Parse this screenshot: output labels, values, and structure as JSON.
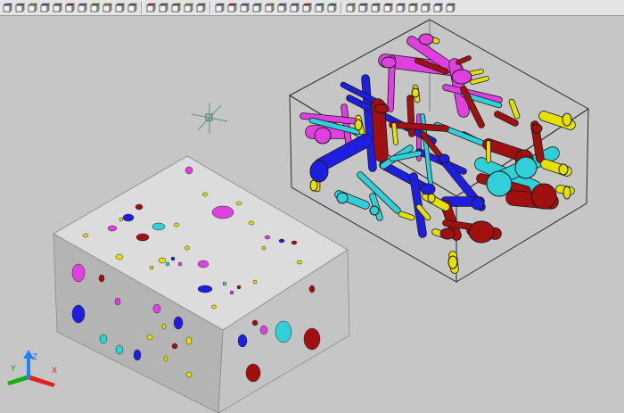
{
  "toolbar": {
    "groups": [
      [
        "box-icon",
        "wedge-icon",
        "sweep-icon",
        "revolve-icon",
        "extrude-icon",
        "loft-icon",
        "union-icon",
        "subtract-icon",
        "intersect-icon",
        "imprint-icon",
        "slice-icon"
      ],
      [
        "section-icon",
        "interference-icon",
        "mass-props-icon",
        "solid-edit-icon",
        "face-color-icon"
      ],
      [
        "top-view-icon",
        "bottom-view-icon",
        "left-view-icon",
        "right-view-icon",
        "front-view-icon",
        "back-view-icon",
        "sw-iso-icon",
        "se-iso-icon",
        "ne-iso-icon",
        "nw-iso-icon"
      ],
      [
        "orbit-icon",
        "pan-icon",
        "zoom-icon",
        "walk-icon",
        "fly-icon",
        "camera-icon",
        "visual-style-icon",
        "render-icon",
        "lights-icon"
      ]
    ]
  },
  "colors": {
    "background": "#c6c6c6",
    "block_top": "#dcdcdc",
    "block_left": "#b4b4b4",
    "block_right": "#c4c4c4",
    "magenta": "#e040e0",
    "blue": "#1e1ee0",
    "cyan": "#30d0d8",
    "darkred": "#a01010",
    "yellow": "#e6e000",
    "axis_x": "#e02020",
    "axis_y": "#10b010",
    "axis_z": "#2080ff"
  },
  "ucs": {
    "z_label": "Z",
    "y_label": "Y",
    "x_label": "X"
  }
}
